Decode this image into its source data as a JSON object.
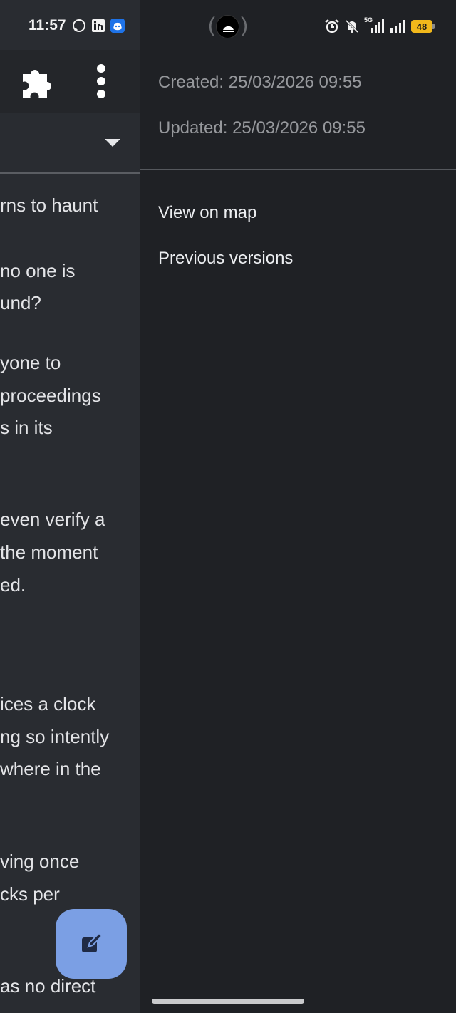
{
  "status_bar": {
    "time": "11:57",
    "left_icons": [
      "whatsapp-icon",
      "linkedin-icon",
      "discord-icon"
    ],
    "network_label": "5G",
    "battery_level": "48",
    "battery_color": "#f1b81b"
  },
  "background_app": {
    "text_fragments": [
      "rns to haunt",
      " no one is",
      "und?",
      "yone to",
      "proceedings",
      "s in its",
      "even verify a",
      "the moment",
      "ed.",
      "ices a clock",
      "ng so intently",
      "where in the",
      "ving once",
      "cks per",
      "as no direct"
    ],
    "fab_color": "#7b9fe4"
  },
  "drawer": {
    "created": "Created: 25/03/2026 09:55",
    "updated": "Updated: 25/03/2026 09:55",
    "actions": [
      {
        "label": "View on map"
      },
      {
        "label": "Previous versions"
      }
    ]
  }
}
